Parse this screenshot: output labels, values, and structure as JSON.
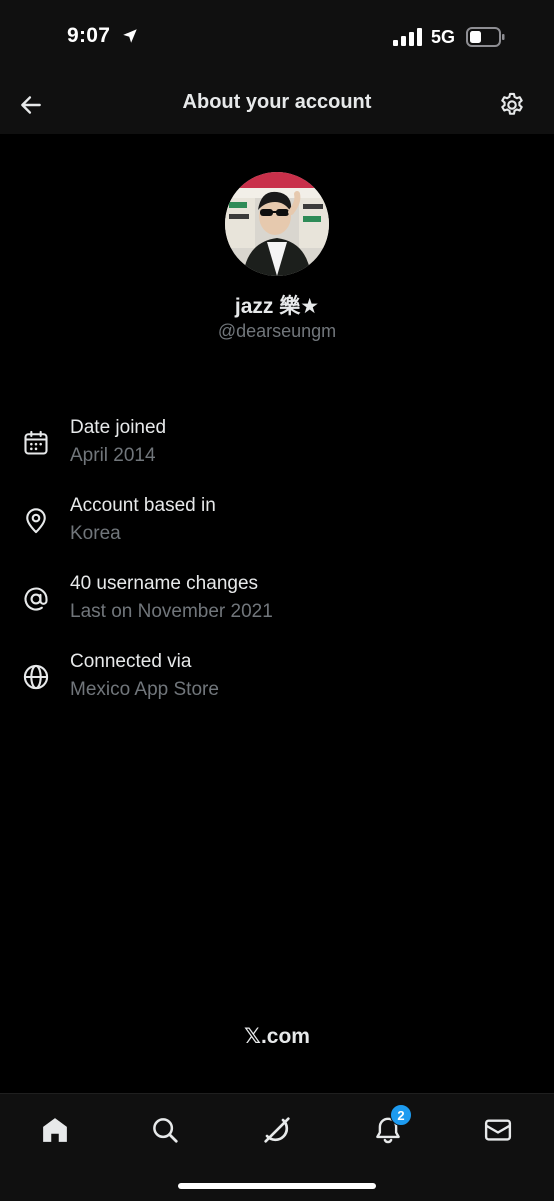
{
  "status_bar": {
    "time": "9:07",
    "network": "5G",
    "icons": [
      "location-arrow-icon",
      "signal-icon",
      "battery-icon"
    ]
  },
  "header": {
    "title": "About your account",
    "back_icon": "arrow-left-icon",
    "settings_icon": "gear-icon"
  },
  "profile": {
    "display_name": "jazz 樂★",
    "username": "@dearseungm"
  },
  "info_items": [
    {
      "icon": "calendar-icon",
      "title": "Date joined",
      "subtitle": "April 2014"
    },
    {
      "icon": "location-pin-icon",
      "title": "Account based in",
      "subtitle": "Korea"
    },
    {
      "icon": "at-sign-icon",
      "title": "40 username changes",
      "subtitle": "Last on November 2021"
    },
    {
      "icon": "globe-icon",
      "title": "Connected via",
      "subtitle": "Mexico App Store"
    }
  ],
  "footer": {
    "brand_logo": "𝕏",
    "brand_text": ".com"
  },
  "bottom_nav": {
    "tabs": [
      "home-icon",
      "search-icon",
      "grok-icon",
      "notifications-icon",
      "messages-icon"
    ],
    "notification_count": "2"
  },
  "colors": {
    "background": "#000000",
    "bar_background": "#101010",
    "primary_text": "#e7e9ea",
    "secondary_text": "#71767b",
    "badge": "#1d9bf0"
  }
}
